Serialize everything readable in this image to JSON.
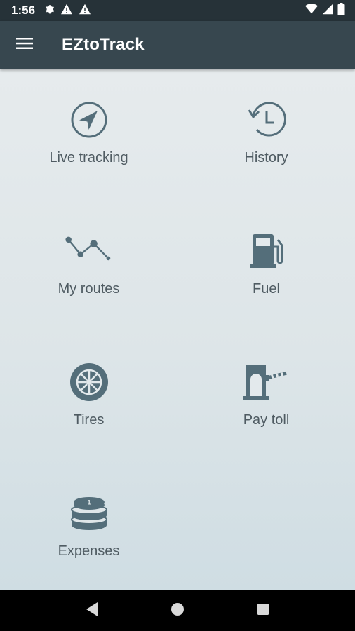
{
  "status_bar": {
    "time": "1:56",
    "left_icons": [
      "gear-icon",
      "warning-icon",
      "warning-icon"
    ],
    "right_icons": [
      "wifi-icon",
      "signal-icon",
      "battery-icon"
    ]
  },
  "app_bar": {
    "title": "EZtoTrack",
    "background": "#37474F"
  },
  "menu": {
    "items": [
      {
        "label": "Live tracking",
        "icon": "navigation-arrow-icon"
      },
      {
        "label": "History",
        "icon": "history-clock-icon"
      },
      {
        "label": "My routes",
        "icon": "routes-icon"
      },
      {
        "label": "Fuel",
        "icon": "fuel-pump-icon"
      },
      {
        "label": "Tires",
        "icon": "tire-icon"
      },
      {
        "label": "Pay toll",
        "icon": "toll-booth-icon"
      },
      {
        "label": "Expenses",
        "icon": "coins-icon"
      }
    ]
  },
  "colors": {
    "icon": "#546E7A",
    "label": "#4f5b62",
    "status_bar": "#263238"
  },
  "nav_bar": {
    "buttons": [
      "back-icon",
      "home-icon",
      "recents-icon"
    ]
  }
}
